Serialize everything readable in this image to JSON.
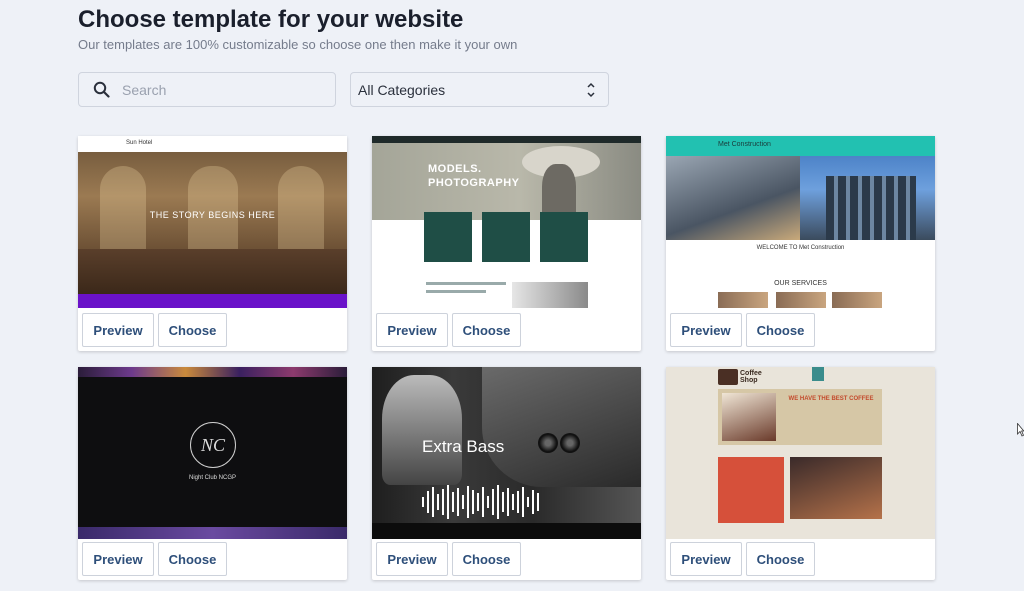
{
  "header": {
    "title": "Choose template for your website",
    "subtitle": "Our templates are 100% customizable so choose one then make it your own"
  },
  "search": {
    "placeholder": "Search",
    "value": ""
  },
  "category_select": {
    "selected": "All Categories"
  },
  "card_actions": {
    "preview_label": "Preview",
    "choose_label": "Choose"
  },
  "templates": [
    {
      "name": "Sun Hotel",
      "headline": "THE STORY BEGINS HERE"
    },
    {
      "name": "Models Photography",
      "headline": "MODELS. PHOTOGRAPHY"
    },
    {
      "name": "Met Construction",
      "headline": "WELCOME TO Met Construction",
      "section": "OUR SERVICES"
    },
    {
      "name": "Night Club NCGP",
      "headline": "Night Club NCGP"
    },
    {
      "name": "Extra Bass",
      "headline": "Extra Bass"
    },
    {
      "name": "Coffee Shop",
      "headline": "WE HAVE THE BEST COFFEE"
    }
  ],
  "colors": {
    "page_bg": "#eef1f7",
    "button_text": "#2e4f7a"
  },
  "icons": {
    "search": "search-icon",
    "select": "chevron-updown-icon",
    "cursor": "mouse-cursor-icon"
  }
}
